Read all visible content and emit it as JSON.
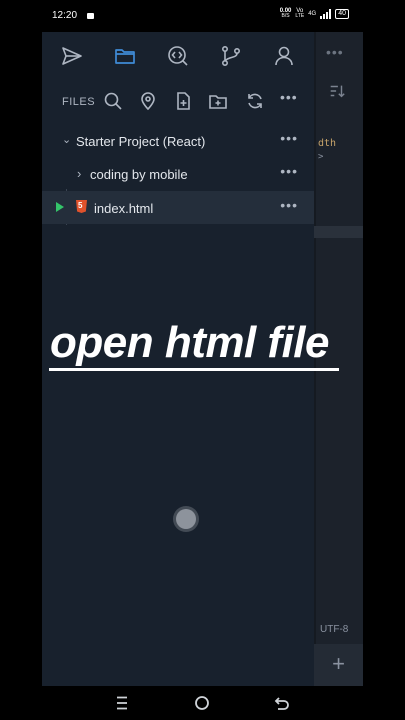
{
  "status_bar": {
    "time": "12:20",
    "net_speed_top": "0.00",
    "net_speed_unit": "B/S",
    "volte": "Vo",
    "lte": "LTE",
    "signal": "4G",
    "battery": "40"
  },
  "sidebar_tabs": [
    {
      "icon": "send-icon"
    },
    {
      "icon": "folder-icon",
      "active": true
    },
    {
      "icon": "search-code-icon"
    },
    {
      "icon": "git-branch-icon"
    },
    {
      "icon": "user-icon"
    }
  ],
  "files_toolbar": {
    "label": "FILES",
    "more": "•••"
  },
  "tree": {
    "project": {
      "chevron": "⌄",
      "name": "Starter Project (React)",
      "more": "•••"
    },
    "folder": {
      "chevron": "›",
      "name": "coding by mobile",
      "more": "•••"
    },
    "file": {
      "name": "index.html",
      "more": "•••"
    }
  },
  "editor": {
    "more": "•••",
    "sort": "⇅",
    "code_line_1": "dth",
    "code_line_2": ">",
    "encoding": "UTF-8",
    "add": "+"
  },
  "caption": "open html file",
  "colors": {
    "panel": "#18212d",
    "selected_row": "#242e3b",
    "accent_icon": "#3f8bd6",
    "play": "#34c46a",
    "html5": "#e0522c"
  }
}
